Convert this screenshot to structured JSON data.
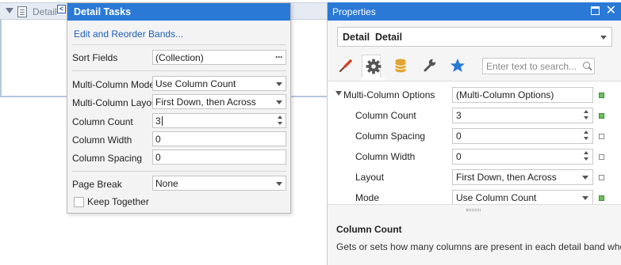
{
  "band": {
    "label": "Detail",
    "smart_tag": "<"
  },
  "tasks": {
    "title": "Detail Tasks",
    "link": "Edit and Reorder Bands...",
    "sort_fields": {
      "label": "Sort Fields",
      "value": "(Collection)",
      "button": "···"
    },
    "multi_column_mode": {
      "label": "Multi-Column Mode",
      "value": "Use Column Count"
    },
    "multi_column_layout": {
      "label": "Multi-Column Layout",
      "value": "First Down, then Across"
    },
    "column_count": {
      "label": "Column Count",
      "value": "3"
    },
    "column_width": {
      "label": "Column Width",
      "value": "0"
    },
    "column_spacing": {
      "label": "Column Spacing",
      "value": "0"
    },
    "page_break": {
      "label": "Page Break",
      "value": "None"
    },
    "keep_together": {
      "label": "Keep Together",
      "checked": false
    }
  },
  "properties": {
    "title": "Properties",
    "object_name": "Detail",
    "object_type": "Detail",
    "toolbar": [
      "brush-icon",
      "gear-icon",
      "database-icon",
      "wrench-icon",
      "star-icon"
    ],
    "active_tab": "gear-icon",
    "search_placeholder": "Enter text to search...",
    "rows": [
      {
        "label": "Multi-Column Options",
        "value": "(Multi-Column Options)",
        "editor": "text",
        "level": 0,
        "expanded": true,
        "set": true
      },
      {
        "label": "Column Count",
        "value": "3",
        "editor": "spin",
        "level": 1,
        "set": true
      },
      {
        "label": "Column Spacing",
        "value": "0",
        "editor": "spin",
        "level": 1,
        "set": false
      },
      {
        "label": "Column Width",
        "value": "0",
        "editor": "spin",
        "level": 1,
        "set": false
      },
      {
        "label": "Layout",
        "value": "First Down, then Across",
        "editor": "dropdown",
        "level": 1,
        "set": false
      },
      {
        "label": "Mode",
        "value": "Use Column Count",
        "editor": "dropdown",
        "level": 1,
        "set": true
      }
    ],
    "description": {
      "title": "Column Count",
      "text": "Gets or sets how many columns are present in each detail band when..."
    }
  },
  "colors": {
    "title_bar": "#2b79d6",
    "link": "#1f5fb8",
    "toolbar_brush": "#d0492f",
    "toolbar_gear": "#555555",
    "toolbar_database": "#e0a530",
    "toolbar_wrench": "#555555",
    "toolbar_star": "#2b79d6",
    "property_set_marker": "#6cbf5a"
  }
}
